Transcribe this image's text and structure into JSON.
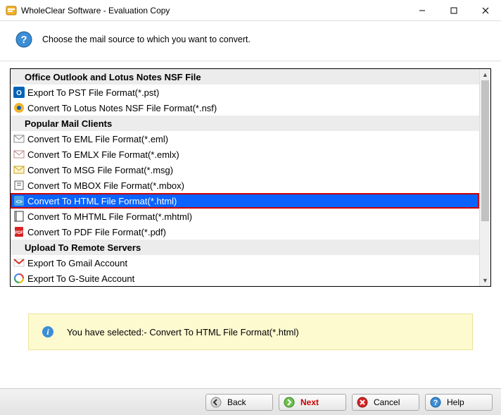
{
  "window": {
    "title": "WholeClear Software - Evaluation Copy"
  },
  "header": {
    "text": "Choose the mail source to which you want to convert."
  },
  "groups": {
    "g1": "Office Outlook and Lotus Notes NSF File",
    "g2": "Popular Mail Clients",
    "g3": "Upload To Remote Servers"
  },
  "items": {
    "pst": "Export To PST File Format(*.pst)",
    "nsf": "Convert To Lotus Notes NSF File Format(*.nsf)",
    "eml": "Convert To EML File Format(*.eml)",
    "emlx": "Convert To EMLX File Format(*.emlx)",
    "msg": "Convert To MSG File Format(*.msg)",
    "mbox": "Convert To MBOX File Format(*.mbox)",
    "html": "Convert To HTML File Format(*.html)",
    "mhtml": "Convert To MHTML File Format(*.mhtml)",
    "pdf": "Convert To PDF File Format(*.pdf)",
    "gmail": "Export To Gmail Account",
    "gsuite": "Export To G-Suite Account"
  },
  "info": {
    "text": "You have selected:- Convert To HTML File Format(*.html)"
  },
  "buttons": {
    "back": "Back",
    "next": "Next",
    "cancel": "Cancel",
    "help": "Help"
  }
}
